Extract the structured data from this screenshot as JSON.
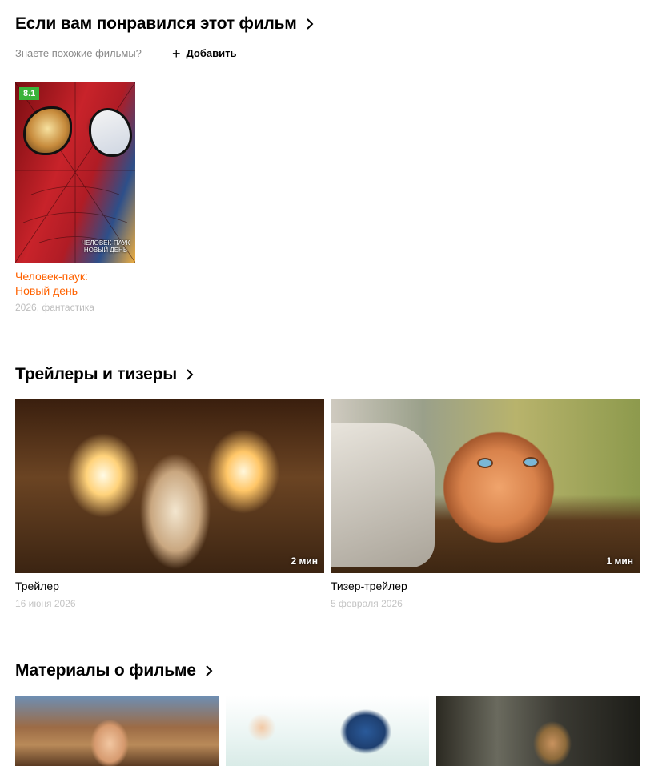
{
  "similar": {
    "title": "Если вам понравился этот фильм",
    "subtitle": "Знаете похожие фильмы?",
    "add_label": "Добавить",
    "items": [
      {
        "rating": "8.1",
        "rating_color": "#3bb33b",
        "title": "Человек-паук:\nНовый день",
        "meta": "2026, фантастика",
        "poster_text": "ЧЕЛОВЕК-ПАУК\nНОВЫЙ ДЕНЬ"
      }
    ]
  },
  "trailers": {
    "title": "Трейлеры и тизеры",
    "items": [
      {
        "title": "Трейлер",
        "date": "16 июня 2026",
        "duration": "2 мин"
      },
      {
        "title": "Тизер-трейлер",
        "date": "5 февраля 2026",
        "duration": "1 мин"
      }
    ]
  },
  "materials": {
    "title": "Материалы о фильме"
  },
  "colors": {
    "accent_title": "#ff6200",
    "meta_gray": "#bdbdbd"
  },
  "icons": {
    "section_arrow": "chevron-right-icon",
    "add": "plus-icon"
  }
}
